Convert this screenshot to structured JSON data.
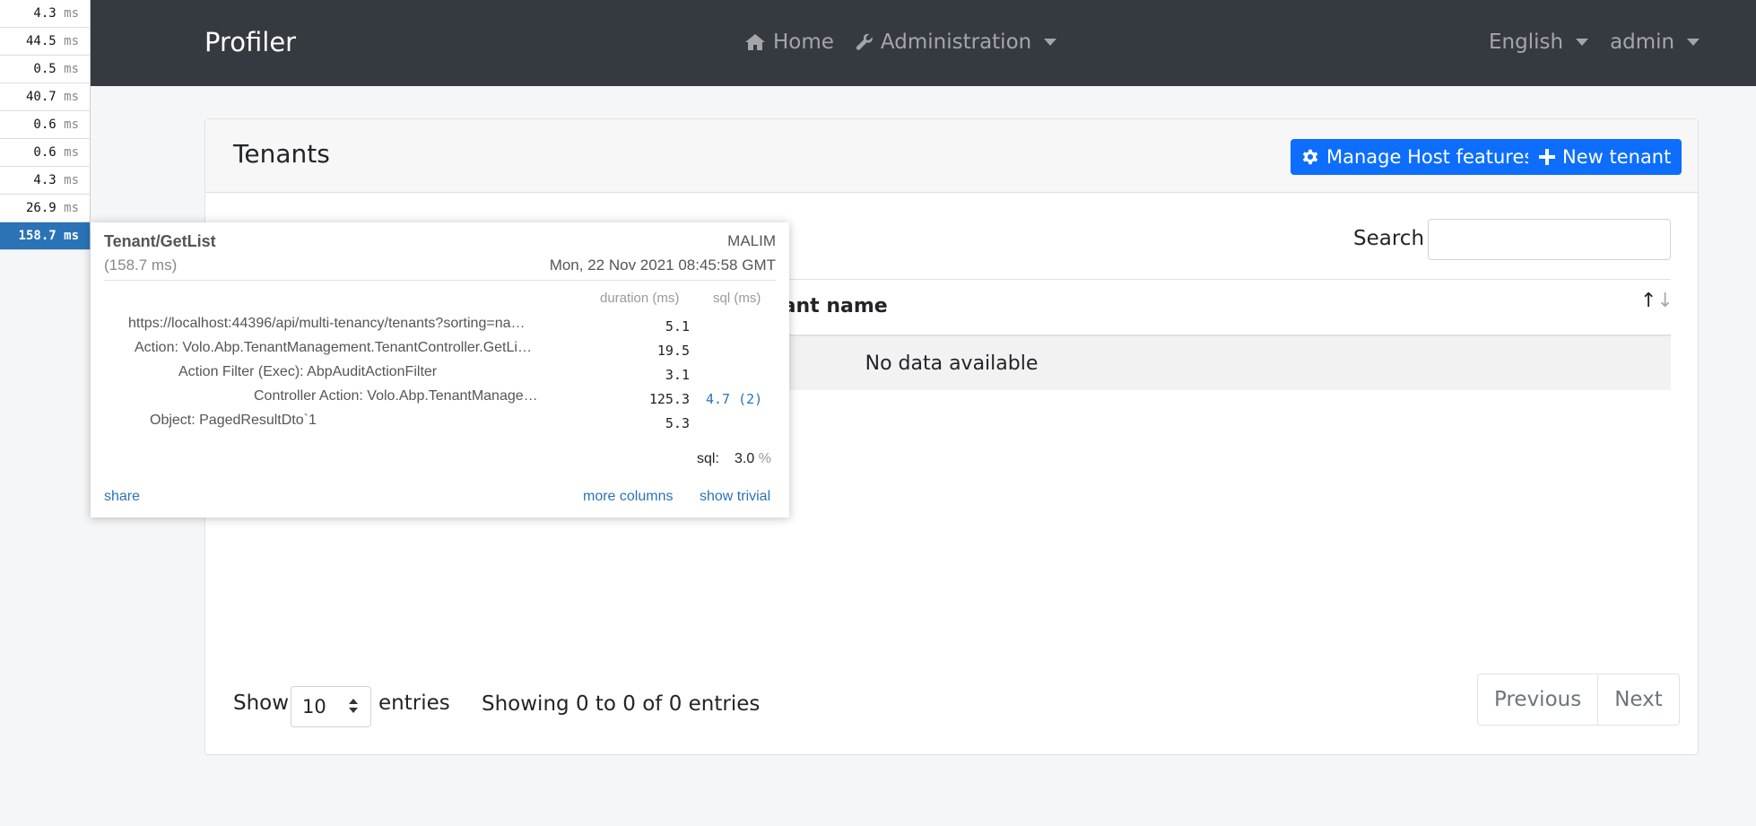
{
  "navbar": {
    "brand": "Profiler",
    "home": "Home",
    "administration": "Administration",
    "language": "English",
    "user": "admin"
  },
  "card": {
    "title": "Tenants",
    "manage_host_features": "Manage Host features",
    "new_tenant": "New tenant",
    "search_label": "Search",
    "search_value": "",
    "column_tenant_name": "nant name",
    "empty_text": "No data available",
    "show_label": "Show",
    "page_length": "10",
    "entries_label": "entries",
    "info": "Showing 0 to 0 of 0 entries",
    "previous": "Previous",
    "next": "Next",
    "sort_up": "↑",
    "sort_down": "↓"
  },
  "profiler": {
    "unit": "ms",
    "timings": [
      "4.3",
      "44.5",
      "0.5",
      "40.7",
      "0.6",
      "0.6",
      "4.3",
      "26.9",
      "158.7"
    ],
    "popup": {
      "name": "Tenant/GetList",
      "total": "(158.7 ms)",
      "machine": "MALIM",
      "date": "Mon, 22 Nov 2021 08:45:58 GMT",
      "col_duration": "duration (ms)",
      "col_sql": "sql (ms)",
      "rows": [
        {
          "label": "https://localhost:44396/api/multi-tenancy/tenants?sorting=na…",
          "duration": "5.1",
          "sql": ""
        },
        {
          "label": "Action: Volo.Abp.TenantManagement.TenantController.GetLi…",
          "duration": "19.5",
          "sql": ""
        },
        {
          "label": "Action Filter (Exec): AbpAuditActionFilter",
          "duration": "3.1",
          "sql": ""
        },
        {
          "label": "Controller Action: Volo.Abp.TenantManage…",
          "duration": "125.3",
          "sql": "4.7 (2)"
        },
        {
          "label": "Object: PagedResultDto`1",
          "duration": "5.3",
          "sql": ""
        }
      ],
      "sql_label": "sql:",
      "sql_percent": "3.0",
      "percent_sign": "%",
      "share": "share",
      "more_columns": "more columns",
      "show_trivial": "show trivial"
    }
  }
}
